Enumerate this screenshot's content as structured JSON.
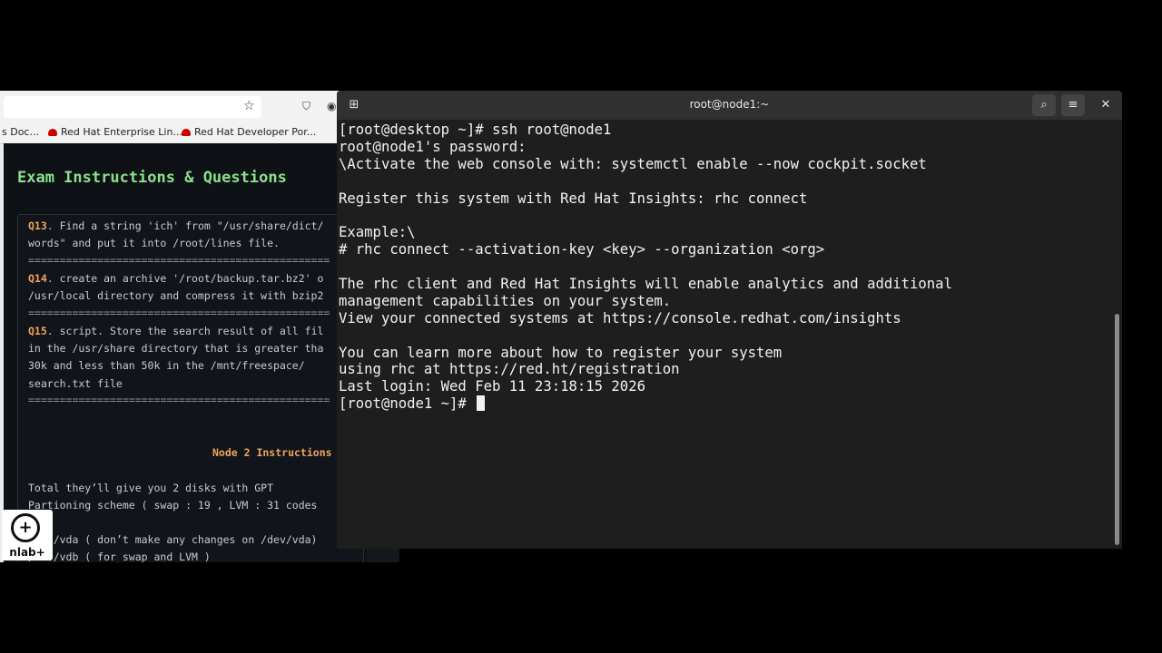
{
  "browser": {
    "bookmarks": [
      {
        "label": "s Doc...",
        "has_icon": false
      },
      {
        "label": "Red Hat Enterprise Lin...",
        "has_icon": true
      },
      {
        "label": "Red Hat Developer Por...",
        "has_icon": true
      }
    ],
    "page": {
      "title": "Exam Instructions & Questions",
      "q13_id": "Q13",
      "q13_line1": ". Find a string 'ich' from \"/usr/share/dict/",
      "q13_line2": "words\" and put it into /root/lines file.",
      "separator": "================================================",
      "q14_id": "Q14",
      "q14_line1": ". create an archive '/root/backup.tar.bz2' o",
      "q14_line2": "/usr/local directory and compress it with bzip2",
      "q15_id": "Q15",
      "q15_line1": ". script. Store the search result of all fil",
      "q15_line2": "in the /usr/share directory that is greater tha",
      "q15_line3": "30k and less than 50k in the /mnt/freespace/",
      "q15_line4": "search.txt file",
      "node2_title": "Node 2 Instructions",
      "p1_line1": "Total they’ll give you 2 disks with GPT",
      "p1_line2": "Partioning scheme ( swap : 19 , LVM : 31 codes",
      "p2_line1": "/dev/vda ( don’t make any changes on /dev/vda)",
      "p2_line2": "/dev/vdb ( for swap and LVM )"
    }
  },
  "logo": {
    "text": "nlab+"
  },
  "terminal": {
    "title": "root@node1:~",
    "lines": [
      "[root@desktop ~]# ssh root@node1",
      "root@node1's password:",
      "\\Activate the web console with: systemctl enable --now cockpit.socket",
      "",
      "Register this system with Red Hat Insights: rhc connect",
      "",
      "Example:\\",
      "# rhc connect --activation-key <key> --organization <org>",
      "",
      "The rhc client and Red Hat Insights will enable analytics and additional",
      "management capabilities on your system.",
      "View your connected systems at https://console.redhat.com/insights",
      "",
      "You can learn more about how to register your system",
      "using rhc at https://red.ht/registration",
      "Last login: Wed Feb 11 23:18:15 2026"
    ],
    "prompt": "[root@node1 ~]# "
  }
}
